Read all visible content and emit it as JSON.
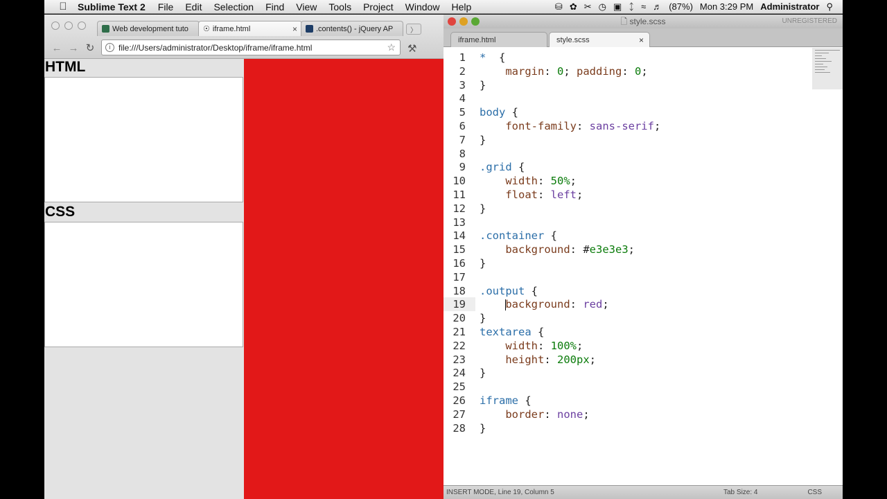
{
  "menubar": {
    "app": "Sublime Text 2",
    "menus": [
      "File",
      "Edit",
      "Selection",
      "Find",
      "View",
      "Tools",
      "Project",
      "Window",
      "Help"
    ],
    "battery": "(87%)",
    "clock": "Mon 3:29 PM",
    "user": "Administrator"
  },
  "browser": {
    "tabs": [
      {
        "label": "Web development tuto",
        "icon": "green-square-icon",
        "active": false
      },
      {
        "label": "iframe.html",
        "icon": "globe-icon",
        "active": true
      },
      {
        "label": ".contents() - jQuery AP",
        "icon": "jquery-icon",
        "active": false
      }
    ],
    "url": "file:///Users/administrator/Desktop/iframe/iframe.html"
  },
  "page": {
    "html_heading": "HTML",
    "css_heading": "CSS"
  },
  "editor": {
    "title": "style.scss",
    "unregistered": "UNREGISTERED",
    "tabs": [
      {
        "label": "iframe.html",
        "active": false
      },
      {
        "label": "style.scss",
        "active": true
      }
    ],
    "current_line": 19,
    "status_mode": "INSERT MODE, Line 19, Column 5",
    "status_tab": "Tab Size: 4",
    "status_syntax": "CSS"
  },
  "code_lines": [
    [
      [
        "star-sel",
        "*"
      ],
      [
        "",
        "  {"
      ]
    ],
    [
      [
        "",
        "    "
      ],
      [
        "prop",
        "margin"
      ],
      [
        "",
        ": "
      ],
      [
        "num",
        "0"
      ],
      [
        "",
        "; "
      ],
      [
        "prop",
        "padding"
      ],
      [
        "",
        ": "
      ],
      [
        "num",
        "0"
      ],
      [
        "",
        ";"
      ]
    ],
    [
      [
        "",
        "}"
      ]
    ],
    [],
    [
      [
        "sel",
        "body"
      ],
      [
        "",
        " {"
      ]
    ],
    [
      [
        "",
        "    "
      ],
      [
        "prop",
        "font-family"
      ],
      [
        "",
        ": "
      ],
      [
        "kw",
        "sans-serif"
      ],
      [
        "",
        ";"
      ]
    ],
    [
      [
        "",
        "}"
      ]
    ],
    [],
    [
      [
        "sel",
        ".grid"
      ],
      [
        "",
        " {"
      ]
    ],
    [
      [
        "",
        "    "
      ],
      [
        "prop",
        "width"
      ],
      [
        "",
        ": "
      ],
      [
        "num",
        "50%"
      ],
      [
        "",
        ";"
      ]
    ],
    [
      [
        "",
        "    "
      ],
      [
        "prop",
        "float"
      ],
      [
        "",
        ": "
      ],
      [
        "kw",
        "left"
      ],
      [
        "",
        ";"
      ]
    ],
    [
      [
        "",
        "}"
      ]
    ],
    [],
    [
      [
        "sel",
        ".container"
      ],
      [
        "",
        " {"
      ]
    ],
    [
      [
        "",
        "    "
      ],
      [
        "prop",
        "background"
      ],
      [
        "",
        ": #"
      ],
      [
        "num",
        "e3e3e3"
      ],
      [
        "",
        ";"
      ]
    ],
    [
      [
        "",
        "}"
      ]
    ],
    [],
    [
      [
        "sel",
        ".output"
      ],
      [
        "",
        " {"
      ]
    ],
    [
      [
        "",
        "    "
      ],
      [
        "prop",
        "background"
      ],
      [
        "",
        ": "
      ],
      [
        "kw",
        "red"
      ],
      [
        "",
        ";"
      ]
    ],
    [
      [
        "",
        "}"
      ]
    ],
    [
      [
        "sel",
        "textarea"
      ],
      [
        "",
        " {"
      ]
    ],
    [
      [
        "",
        "    "
      ],
      [
        "prop",
        "width"
      ],
      [
        "",
        ": "
      ],
      [
        "num",
        "100%"
      ],
      [
        "",
        ";"
      ]
    ],
    [
      [
        "",
        "    "
      ],
      [
        "prop",
        "height"
      ],
      [
        "",
        ": "
      ],
      [
        "num",
        "200px"
      ],
      [
        "",
        ";"
      ]
    ],
    [
      [
        "",
        "}"
      ]
    ],
    [],
    [
      [
        "sel",
        "iframe"
      ],
      [
        "",
        " {"
      ]
    ],
    [
      [
        "",
        "    "
      ],
      [
        "prop",
        "border"
      ],
      [
        "",
        ": "
      ],
      [
        "kw",
        "none"
      ],
      [
        "",
        ";"
      ]
    ],
    [
      [
        "",
        "}"
      ]
    ]
  ]
}
